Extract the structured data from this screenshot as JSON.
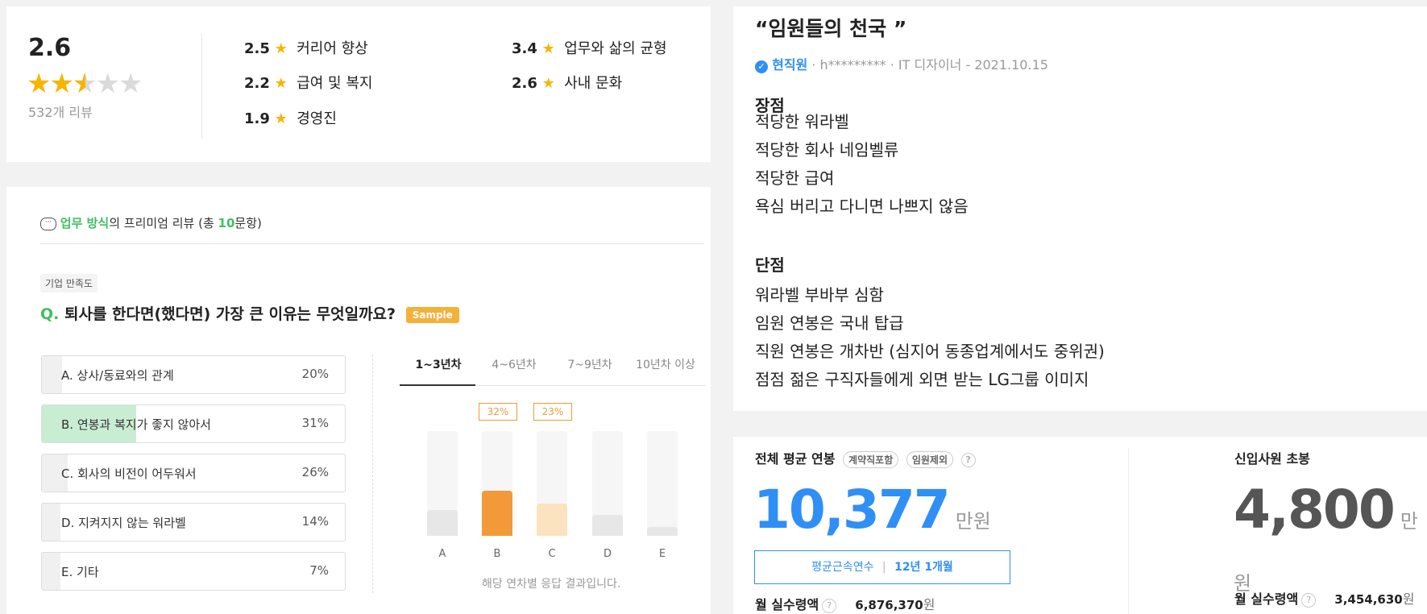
{
  "rating": {
    "score": "2.6",
    "stars": 2.6,
    "review_count": "532개 리뷰",
    "categories": [
      {
        "score": "2.5",
        "label": "커리어 향상"
      },
      {
        "score": "3.4",
        "label": "업무와 삶의 균형"
      },
      {
        "score": "2.2",
        "label": "급여 및 복지"
      },
      {
        "score": "2.6",
        "label": "사내 문화"
      },
      {
        "score": "1.9",
        "label": "경영진"
      }
    ]
  },
  "premium": {
    "title_green": "업무 방식",
    "title_rest": "의 프리미엄 리뷰 (총 ",
    "count": "10",
    "title_end": "문항)",
    "badge": "기업 만족도",
    "q_prefix": "Q.",
    "question": "퇴사를 한다면(했다면) 가장 큰 이유는 무엇일까요?",
    "sample": "Sample",
    "options": [
      {
        "label": "A. 상사/동료와의 관계",
        "pct": "20%",
        "value": 20
      },
      {
        "label": "B. 연봉과 복지가 좋지 않아서",
        "pct": "31%",
        "value": 31
      },
      {
        "label": "C. 회사의 비전이 어두워서",
        "pct": "26%",
        "value": 26
      },
      {
        "label": "D. 지켜지지 않는 워라벨",
        "pct": "14%",
        "value": 14
      },
      {
        "label": "E. 기타",
        "pct": "7%",
        "value": 7
      }
    ],
    "tabs": [
      "1~3년차",
      "4~6년차",
      "7~9년차",
      "10년차 이상"
    ],
    "footnote": "해당 연차별 응답 결과입니다."
  },
  "chart_data": {
    "type": "bar",
    "categories": [
      "A",
      "B",
      "C",
      "D",
      "E"
    ],
    "values": [
      18,
      32,
      23,
      15,
      6
    ],
    "labels": [
      "",
      "32%",
      "23%",
      "",
      ""
    ],
    "colors": [
      "#e7e7e8",
      "#f29a3a",
      "#fbe3c0",
      "#e7e7e8",
      "#e7e7e8"
    ],
    "ylim": [
      0,
      100
    ]
  },
  "review": {
    "title": "“임원들의 천국 ”",
    "verified": "현직원",
    "meta": " · h********* · IT 디자이너 - 2021.10.15",
    "pros_title": "장점",
    "pros": [
      "적당한 워라벨",
      "적당한 회사 네임벨류",
      "적당한 급여",
      "욕심 버리고 다니면 나쁘지 않음"
    ],
    "cons_title": "단점",
    "cons": [
      "워라벨 부바부 심함",
      "임원 연봉은 국내 탑급",
      "직원 연봉은 개차반 (심지어 동종업계에서도 중위권)",
      "점점 젊은 구직자들에게 외면 받는 LG그룹 이미지"
    ]
  },
  "salary": {
    "avg_label": "전체 평균 연봉",
    "pill1": "계약직포함",
    "pill2": "임원제외",
    "avg_value": "10,377",
    "unit": "만원",
    "tenure_label": "평균근속연수",
    "tenure_value": "12년 1개월",
    "monthly_label": "월 실수령액",
    "monthly_value": "6,876,370",
    "won": "원",
    "starting_label": "신입사원 초봉",
    "starting_value": "4,800",
    "starting_monthly_value": "3,454,630"
  },
  "colors": {
    "accent_green": "#3fbf5f",
    "accent_blue": "#2f8ff5",
    "star": "#f7b500",
    "bar_orange": "#f29a3a"
  }
}
